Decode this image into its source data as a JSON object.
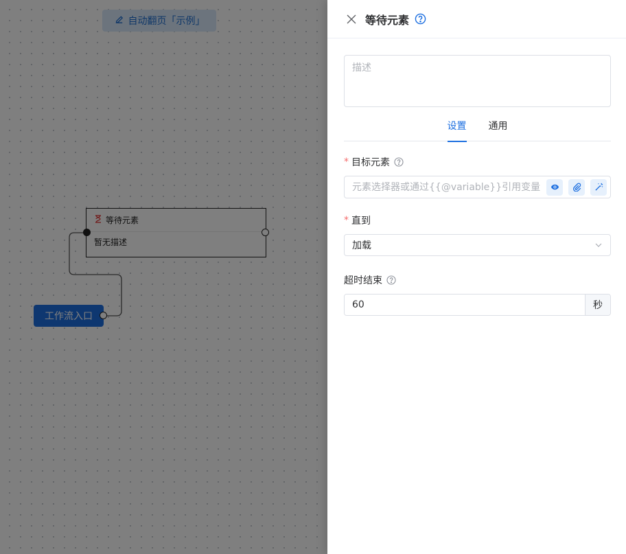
{
  "canvas": {
    "workflow_title": "自动翻页「示例」",
    "entry_node_label": "工作流入口",
    "node": {
      "title": "等待元素",
      "description": "暂无描述",
      "icon": "hourglass-icon"
    }
  },
  "drawer": {
    "title": "等待元素",
    "description_placeholder": "描述",
    "tabs": [
      {
        "label": "设置",
        "active": true
      },
      {
        "label": "通用",
        "active": false
      }
    ],
    "target": {
      "label": "目标元素",
      "placeholder": "元素选择器或通过{{@variable}}引用变量",
      "value": "",
      "actions": [
        "eye-icon",
        "paperclip-icon",
        "magic-wand-icon"
      ]
    },
    "until": {
      "label": "直到",
      "selected": "加载"
    },
    "timeout": {
      "label": "超时结束",
      "value": "60",
      "unit": "秒"
    }
  },
  "colors": {
    "primary": "#1d6fe0",
    "required": "#f56c6c",
    "node_icon": "#e03131"
  }
}
